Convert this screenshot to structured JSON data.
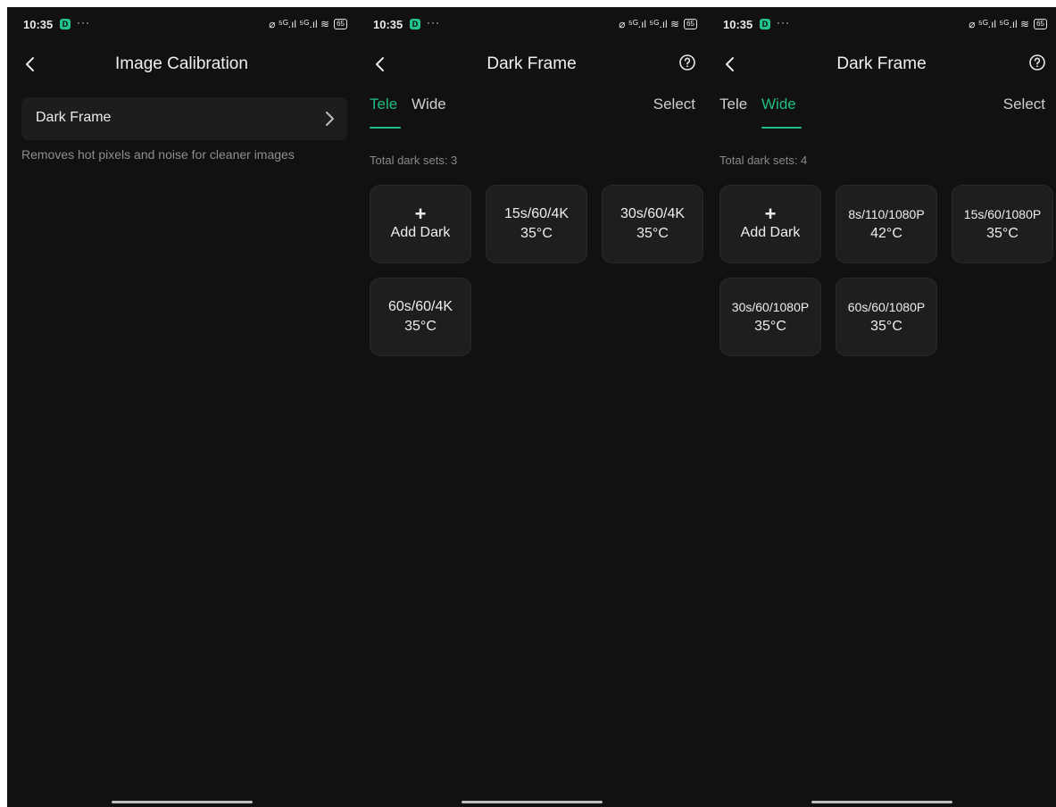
{
  "status_bar": {
    "time": "10:35",
    "badge": "D",
    "more": "···",
    "signal": "⌀ ⁵ᴳ.ıl ⁵ᴳ.ıl ≋",
    "battery": "65"
  },
  "screen1": {
    "title": "Image Calibration",
    "row_label": "Dark Frame",
    "description": "Removes hot pixels and noise for cleaner images"
  },
  "screen2": {
    "title": "Dark Frame",
    "tabs": [
      "Tele",
      "Wide"
    ],
    "active_tab": "Tele",
    "select_label": "Select",
    "total": "Total dark sets: 3",
    "add_label": "Add Dark",
    "cards": [
      {
        "line1": "15s/60/4K",
        "line2": "35°C"
      },
      {
        "line1": "30s/60/4K",
        "line2": "35°C"
      },
      {
        "line1": "60s/60/4K",
        "line2": "35°C"
      }
    ]
  },
  "screen3": {
    "title": "Dark Frame",
    "tabs": [
      "Tele",
      "Wide"
    ],
    "active_tab": "Wide",
    "select_label": "Select",
    "total": "Total dark sets: 4",
    "add_label": "Add Dark",
    "cards": [
      {
        "line1": "8s/110/1080P",
        "line2": "42°C"
      },
      {
        "line1": "15s/60/1080P",
        "line2": "35°C"
      },
      {
        "line1": "30s/60/1080P",
        "line2": "35°C"
      },
      {
        "line1": "60s/60/1080P",
        "line2": "35°C"
      }
    ]
  },
  "colors": {
    "accent": "#1fbf83",
    "background": "#111111",
    "card": "#1e1e1e"
  }
}
